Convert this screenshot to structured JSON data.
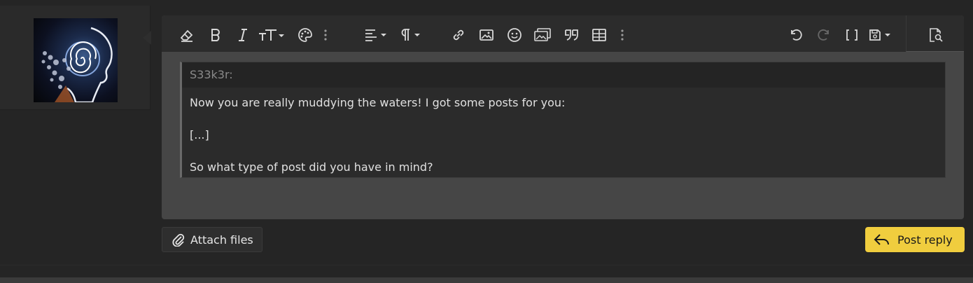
{
  "toolbar": {
    "buttons": [
      {
        "name": "remove-format",
        "icon": "eraser-icon"
      },
      {
        "name": "bold",
        "icon": "bold-icon"
      },
      {
        "name": "italic",
        "icon": "italic-icon"
      },
      {
        "name": "text-size",
        "icon": "text-size-icon"
      },
      {
        "name": "text-color",
        "icon": "palette-icon"
      },
      {
        "name": "more-text",
        "icon": "more-vertical-icon"
      },
      {
        "name": "align",
        "icon": "align-left-icon"
      },
      {
        "name": "paragraph",
        "icon": "paragraph-icon"
      },
      {
        "name": "link",
        "icon": "link-icon"
      },
      {
        "name": "image",
        "icon": "image-icon"
      },
      {
        "name": "emoji",
        "icon": "smiley-icon"
      },
      {
        "name": "media-gallery",
        "icon": "gallery-icon"
      },
      {
        "name": "quote",
        "icon": "quote-icon"
      },
      {
        "name": "table",
        "icon": "table-icon"
      },
      {
        "name": "more-insert",
        "icon": "more-vertical-icon"
      },
      {
        "name": "undo",
        "icon": "undo-icon"
      },
      {
        "name": "redo",
        "icon": "redo-icon"
      },
      {
        "name": "bbcode",
        "icon": "brackets-icon"
      },
      {
        "name": "drafts",
        "icon": "save-icon"
      },
      {
        "name": "preview",
        "icon": "preview-icon"
      }
    ]
  },
  "quote": {
    "author": "S33k3r:",
    "lines": [
      "Now you are really muddying the waters! I got some posts for you:",
      "[...]",
      "So what type of post did you have in mind?"
    ]
  },
  "actions": {
    "attach_label": "Attach files",
    "reply_label": "Post reply"
  },
  "colors": {
    "accent": "#f0cd3e",
    "editor_bg": "#464646",
    "toolbar_bg": "#2c2c2c",
    "page_bg": "#252525"
  }
}
